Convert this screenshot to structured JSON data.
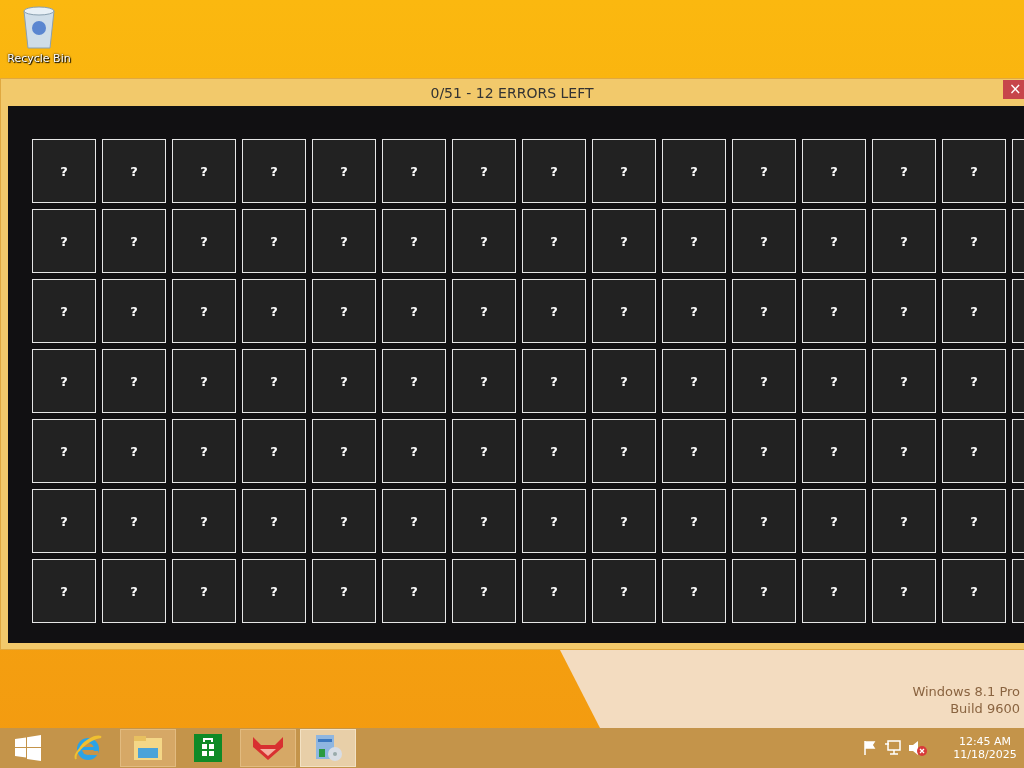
{
  "desktop": {
    "icons": [
      {
        "label": "Recycle Bin"
      }
    ],
    "watermark": [
      "Windows 8.1 Pro",
      "Build 9600"
    ]
  },
  "window": {
    "title": "0/51 - 12 ERRORS LEFT",
    "close": "×"
  },
  "grid": {
    "rows": [
      {
        "cells": [
          "?",
          "?",
          "?",
          "?",
          "?",
          "?",
          "?",
          "?",
          "?",
          "?",
          "?",
          "?",
          "?",
          "?"
        ]
      },
      {
        "cells": [
          "?",
          "?",
          "?",
          "?",
          "?",
          "?",
          "?",
          "?",
          "?",
          "?",
          "?",
          "?",
          "?",
          "?"
        ]
      },
      {
        "cells": [
          "?",
          "?",
          "?",
          "?",
          "?",
          "?",
          "?",
          "?",
          "?",
          "?",
          "?",
          "?",
          "?",
          "?"
        ]
      },
      {
        "cells": [
          "?",
          "?",
          "?",
          "?",
          "?",
          "?",
          "?",
          "?",
          "?",
          "?",
          "?",
          "?",
          "?",
          "?"
        ]
      },
      {
        "cells": [
          "?",
          "?",
          "?",
          "?",
          "?",
          "?",
          "?",
          "?",
          "?",
          "?",
          "?",
          "?",
          "?",
          "?"
        ]
      },
      {
        "cells": [
          "?",
          "?",
          "?",
          "?",
          "?",
          "?",
          "?",
          "?",
          "?",
          "?",
          "?",
          "?",
          "?",
          "?"
        ]
      },
      {
        "cells": [
          "?",
          "?",
          "?",
          "?",
          "?",
          "?",
          "?",
          "?",
          "?",
          "?",
          "?",
          "?",
          "?",
          "?"
        ]
      }
    ]
  },
  "taskbar": {
    "apps": [
      {
        "kind": "start"
      },
      {
        "kind": "browser"
      },
      {
        "kind": "files",
        "selected": false
      },
      {
        "kind": "store"
      },
      {
        "kind": "fox",
        "selected": false
      },
      {
        "kind": "game",
        "selected": true
      }
    ],
    "clock": {
      "time": "12:45 AM",
      "date": "11/18/2025"
    }
  }
}
